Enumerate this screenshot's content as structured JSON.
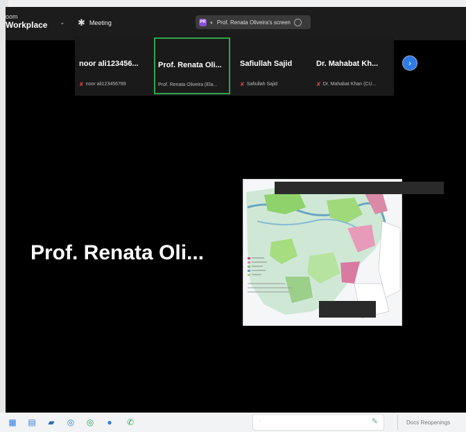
{
  "app": {
    "brand_line1": "oom",
    "brand_line2": "Workplace",
    "caret": "⌄",
    "meeting_label": "Meeting",
    "share_pill": {
      "avatar": "PR",
      "text": "Prof. Renata Oliveira's screen"
    }
  },
  "participants": [
    {
      "name": "noor ali123456...",
      "subtitle": "noor ali123456789",
      "active": false
    },
    {
      "name": "Prof. Renata Oli...",
      "subtitle": "Prof. Renata Oliveira (Ela...",
      "active": true
    },
    {
      "name": "Safiullah Sajid",
      "subtitle": "Safiullah Sajid",
      "active": false
    },
    {
      "name": "Dr. Mahabat Kh...",
      "subtitle": "Dr. Mahabat Khan (CU...",
      "active": false
    }
  ],
  "next_button": "›",
  "speaker_name": "Prof. Renata Oli...",
  "taskbar": {
    "search_placeholder": "Docs Reopenings",
    "icons": [
      "start-icon",
      "task-view-icon",
      "file-explorer-icon",
      "edge-icon",
      "edge-beta-icon",
      "zoom-icon",
      "whatsapp-icon"
    ]
  },
  "colors": {
    "active_border": "#2ea84a",
    "accent_blue": "#2d7be5",
    "muted_mic": "#e04040"
  }
}
